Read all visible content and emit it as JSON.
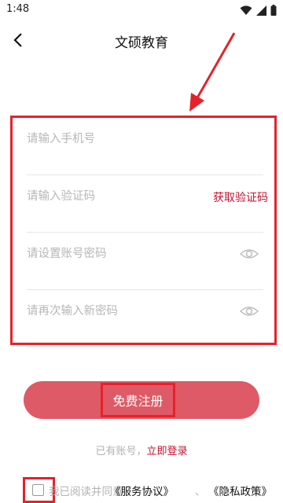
{
  "status_bar": {
    "time": "1:48"
  },
  "header": {
    "title": "文硕教育"
  },
  "form": {
    "phone_placeholder": "请输入手机号",
    "code_placeholder": "请输入验证码",
    "get_code_label": "获取验证码",
    "password_placeholder": "请设置账号密码",
    "confirm_placeholder": "请再次输入新密码"
  },
  "register_button": {
    "label": "免费注册"
  },
  "login_prompt": {
    "text": "已有账号，",
    "link": "立即登录"
  },
  "agreement": {
    "text": "我已阅读并同意",
    "service_link": "《服务协议》",
    "separator": "、",
    "privacy_link": "《隐私政策》"
  },
  "colors": {
    "accent": "#c8102e",
    "button_bg": "#dd5a66",
    "annotation": "#e8202a"
  }
}
